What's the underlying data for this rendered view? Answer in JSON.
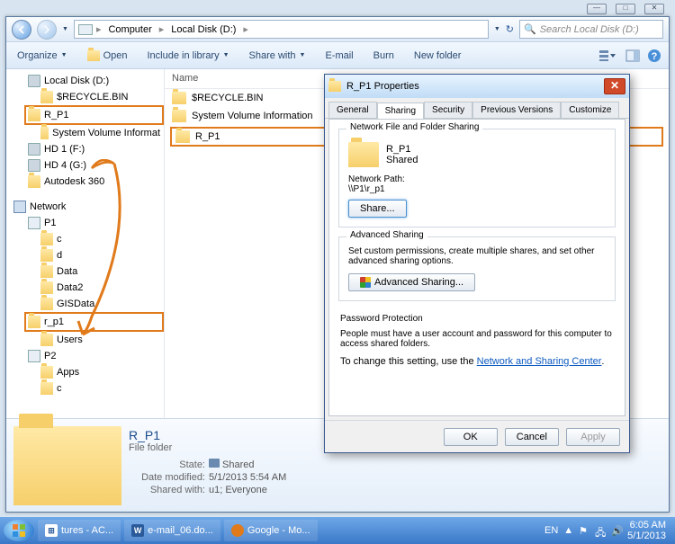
{
  "window_controls": {
    "min": "—",
    "max": "□",
    "close": "✕"
  },
  "breadcrumb": {
    "item0": "Computer",
    "item1": "Local Disk (D:)"
  },
  "search": {
    "placeholder": "Search Local Disk (D:)"
  },
  "toolbar": {
    "organize": "Organize",
    "open": "Open",
    "include": "Include in library",
    "share": "Share with",
    "email": "E-mail",
    "burn": "Burn",
    "newfolder": "New folder"
  },
  "tree": {
    "ldisk": "Local Disk (D:)",
    "recycle": "$RECYCLE.BIN",
    "rp1": "R_P1",
    "sysvol": "System Volume Informat",
    "hd1": "HD 1 (F:)",
    "hd4": "HD 4 (G:)",
    "autodesk": "Autodesk 360",
    "network": "Network",
    "p1": "P1",
    "c": "c",
    "d": "d",
    "data": "Data",
    "data2": "Data2",
    "gis": "GISData",
    "rp1_net": "r_p1",
    "users": "Users",
    "p2": "P2",
    "apps": "Apps",
    "c2": "c"
  },
  "list": {
    "col_name": "Name",
    "recycle": "$RECYCLE.BIN",
    "sysvol": "System Volume Information",
    "rp1": "R_P1"
  },
  "details": {
    "title": "R_P1",
    "type": "File folder",
    "state_k": "State:",
    "state_v": "Shared",
    "mod_k": "Date modified:",
    "mod_v": "5/1/2013 5:54 AM",
    "shared_k": "Shared with:",
    "shared_v": "u1; Everyone"
  },
  "dialog": {
    "title": "R_P1 Properties",
    "tabs": {
      "general": "General",
      "sharing": "Sharing",
      "security": "Security",
      "prev": "Previous Versions",
      "custom": "Customize"
    },
    "g1_title": "Network File and Folder Sharing",
    "share_name": "R_P1",
    "share_status": "Shared",
    "np_label": "Network Path:",
    "np_val": "\\\\P1\\r_p1",
    "share_btn": "Share...",
    "g2_title": "Advanced Sharing",
    "g2_text": "Set custom permissions, create multiple shares, and set other advanced sharing options.",
    "adv_btn": "Advanced Sharing...",
    "g3_title": "Password Protection",
    "g3_text1": "People must have a user account and password for this computer to access shared folders.",
    "g3_text2a": "To change this setting, use the ",
    "g3_link": "Network and Sharing Center",
    "ok": "OK",
    "cancel": "Cancel",
    "apply": "Apply"
  },
  "taskbar": {
    "t0": "tures - AC...",
    "t1": "e-mail_06.do...",
    "t2": "Google - Mo...",
    "lang": "EN",
    "time": "6:05 AM",
    "date": "5/1/2013"
  }
}
